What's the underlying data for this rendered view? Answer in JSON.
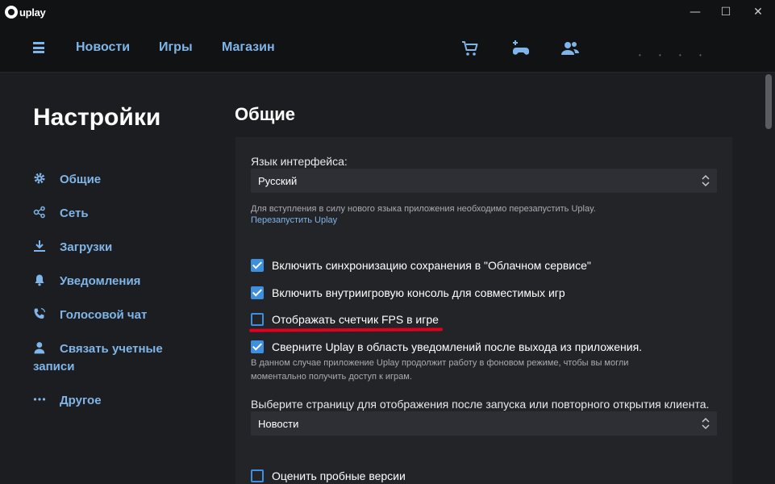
{
  "window": {
    "logo_text": "uplay",
    "controls": {
      "minimize": "—",
      "maximize": "☐",
      "close": "✕"
    }
  },
  "topnav": {
    "links": [
      "Новости",
      "Игры",
      "Магазин"
    ]
  },
  "sidebar": {
    "title": "Настройки",
    "items": [
      {
        "label": "Общие",
        "icon": "gear-icon"
      },
      {
        "label": "Сеть",
        "icon": "network-icon"
      },
      {
        "label": "Загрузки",
        "icon": "download-icon"
      },
      {
        "label": "Уведомления",
        "icon": "bell-icon"
      },
      {
        "label": "Голосовой чат",
        "icon": "phone-icon"
      },
      {
        "label": "Связать учетные записи",
        "icon": "user-icon"
      },
      {
        "label": "Другое",
        "icon": "more-icon"
      }
    ]
  },
  "main": {
    "title": "Общие",
    "language": {
      "label": "Язык интерфейса:",
      "value": "Русский",
      "note": "Для вступления в силу нового языка приложения необходимо перезапустить Uplay.",
      "restart_link": "Перезапустить Uplay"
    },
    "options": [
      {
        "label": "Включить синхронизацию сохранения в \"Облачном сервисе\"",
        "checked": true
      },
      {
        "label": "Включить внутриигровую консоль для совместимых игр",
        "checked": true
      },
      {
        "label": "Отображать счетчик FPS в игре",
        "checked": false
      },
      {
        "label": "Сверните Uplay в область уведомлений после выхода из приложения.",
        "checked": true
      }
    ],
    "minimize_note": "В данном случае приложение Uplay продолжит работу в фоновом режиме, чтобы вы могли моментально получить доступ к играм.",
    "startpage": {
      "label": "Выберите страницу для отображения после запуска или повторного открытия клиента.",
      "value": "Новости"
    },
    "trial": {
      "label": "Оценить пробные версии",
      "checked": false
    }
  },
  "colors": {
    "accent": "#7fb5e8",
    "checkbox": "#3d8fe0",
    "highlight": "#e1001e",
    "background": "#1c1d21"
  }
}
